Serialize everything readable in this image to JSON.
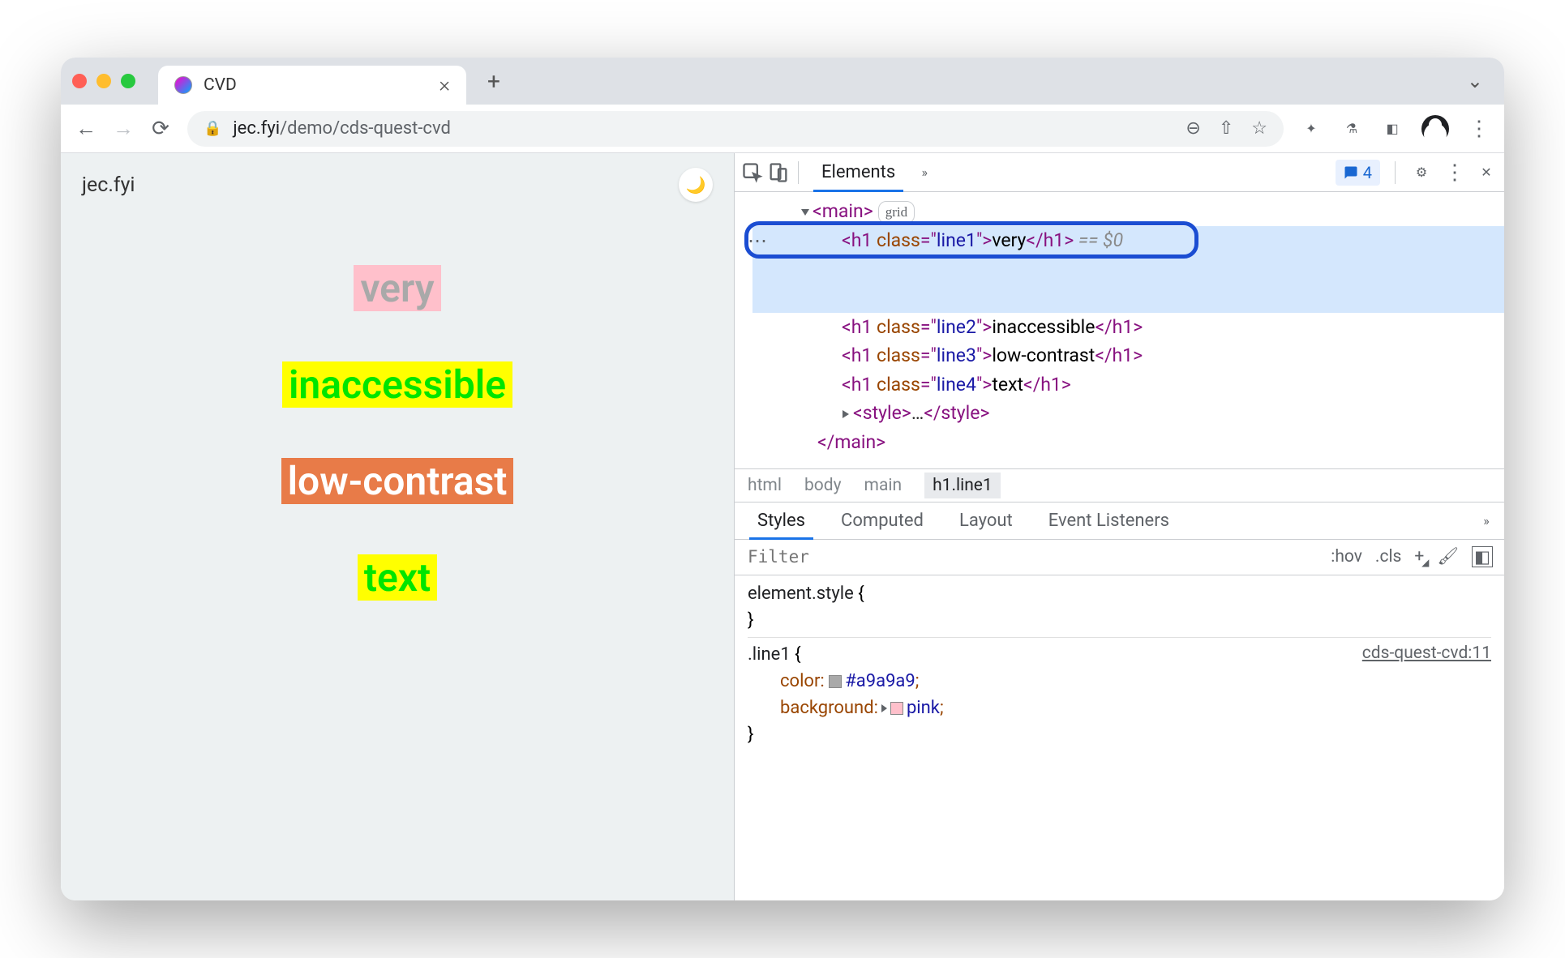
{
  "tabstrip": {
    "title": "CVD"
  },
  "toolbar": {
    "url_host": "jec.fyi",
    "url_path": "/demo/cds-quest-cvd"
  },
  "page": {
    "brand": "jec.fyi",
    "line1": "very",
    "line2": "inaccessible",
    "line3": "low-contrast",
    "line4": "text"
  },
  "devtools": {
    "tabs": {
      "elements": "Elements"
    },
    "issues_count": "4",
    "dom": {
      "main_open": "main",
      "main_badge": "grid",
      "h1_tag": "h1",
      "class_attr": "class",
      "line1_class": "line1",
      "line1_text": "very",
      "eq0": " == $0",
      "line2_class": "line2",
      "line2_text": "inaccessible",
      "line3_class": "line3",
      "line3_text": "low-contrast",
      "line4_class": "line4",
      "line4_text": "text",
      "style_tag": "style",
      "ellipsis": "…",
      "main_close": "main"
    },
    "crumbs": {
      "html": "html",
      "body": "body",
      "main": "main",
      "h1": "h1.line1"
    },
    "styles_tabs": {
      "styles": "Styles",
      "computed": "Computed",
      "layout": "Layout",
      "listeners": "Event Listeners"
    },
    "filter": {
      "placeholder": "Filter",
      "hov": ":hov",
      "cls": ".cls"
    },
    "rules": {
      "element_style": "element.style",
      "line1_sel": ".line1",
      "src": "cds-quest-cvd:11",
      "color_prop": "color",
      "color_val": "#a9a9a9",
      "bg_prop": "background",
      "bg_val": "pink"
    }
  }
}
